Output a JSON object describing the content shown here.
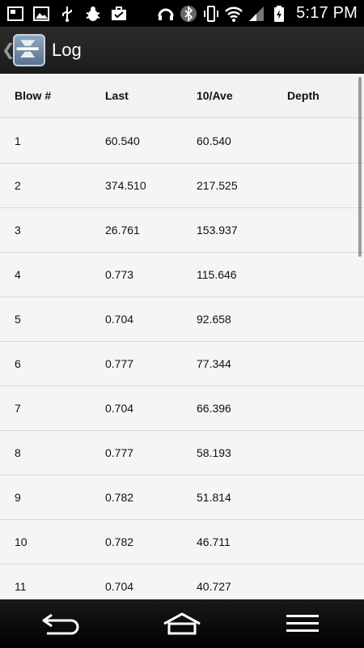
{
  "status_bar": {
    "time": "5:17 PM",
    "icons": [
      "screenshot-icon",
      "image-icon",
      "usb-icon",
      "debug-bug-icon",
      "briefcase-check-icon",
      "headset-icon",
      "bluetooth-icon",
      "vibrate-icon",
      "wifi-icon",
      "signal-icon",
      "battery-charging-icon"
    ]
  },
  "action_bar": {
    "title": "Log",
    "up_indicator": "❮"
  },
  "table": {
    "headers": [
      "Blow #",
      "Last",
      "10/Ave",
      "Depth"
    ],
    "rows": [
      {
        "blow": "1",
        "last": "60.540",
        "ave": "60.540",
        "depth": ""
      },
      {
        "blow": "2",
        "last": "374.510",
        "ave": "217.525",
        "depth": ""
      },
      {
        "blow": "3",
        "last": "26.761",
        "ave": "153.937",
        "depth": ""
      },
      {
        "blow": "4",
        "last": "0.773",
        "ave": "115.646",
        "depth": ""
      },
      {
        "blow": "5",
        "last": "0.704",
        "ave": "92.658",
        "depth": ""
      },
      {
        "blow": "6",
        "last": "0.777",
        "ave": "77.344",
        "depth": ""
      },
      {
        "blow": "7",
        "last": "0.704",
        "ave": "66.396",
        "depth": ""
      },
      {
        "blow": "8",
        "last": "0.777",
        "ave": "58.193",
        "depth": ""
      },
      {
        "blow": "9",
        "last": "0.782",
        "ave": "51.814",
        "depth": ""
      },
      {
        "blow": "10",
        "last": "0.782",
        "ave": "46.711",
        "depth": ""
      },
      {
        "blow": "11",
        "last": "0.704",
        "ave": "40.727",
        "depth": ""
      }
    ]
  },
  "nav_bar": {
    "buttons": [
      "back-icon",
      "home-icon",
      "menu-icon"
    ]
  }
}
